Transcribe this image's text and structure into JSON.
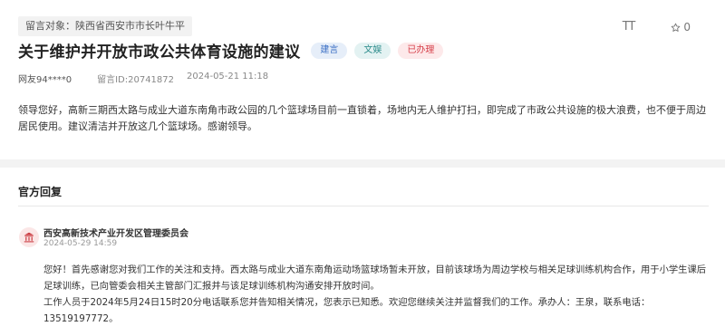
{
  "message": {
    "target_label": "留言对象：陕西省西安市市长叶牛平",
    "title": "关于维护并开放市政公共体育设施的建议",
    "tags": [
      "建言",
      "文娱",
      "已办理"
    ],
    "user": "网友94****0",
    "message_id": "留言ID:20741872",
    "datetime": "2024-05-21 11:18",
    "content": "领导您好，高新三期西太路与成业大道东南角市政公园的几个篮球场目前一直锁着，场地内无人维护打扫，即完成了市政公共设施的极大浪费，也不便于周边居民使用。建议清洁并开放这几个篮球场。感谢领导。"
  },
  "toolbar": {
    "font_icon_label": "TT",
    "star_count": "0"
  },
  "reply": {
    "header": "官方回复",
    "org_name": "西安高新技术产业开发区管理委员会",
    "date": "2024-05-29 14:59",
    "content_line1": "您好！首先感谢您对我们工作的关注和支持。西太路与成业大道东南角运动场篮球场暂未开放，目前该球场为周边学校与相关足球训练机构合作，用于小学生课后足球训练，已向管委会相关主管部门汇报并与该足球训练机构沟通安排开放时间。",
    "content_line2": "工作人员于2024年5月24日15时20分电话联系您并告知相关情况，您表示已知悉。欢迎您继续关注并监督我们的工作。承办人：王泉，联系电话：13519197772。"
  },
  "icons": {
    "font_size": "font-size-icon",
    "star": "star-icon",
    "org": "government-building-icon"
  },
  "colors": {
    "tag_blue": "#3a6fc4",
    "tag_teal": "#2b8b8b",
    "tag_red": "#d6404a",
    "org_icon": "#c9363c"
  }
}
